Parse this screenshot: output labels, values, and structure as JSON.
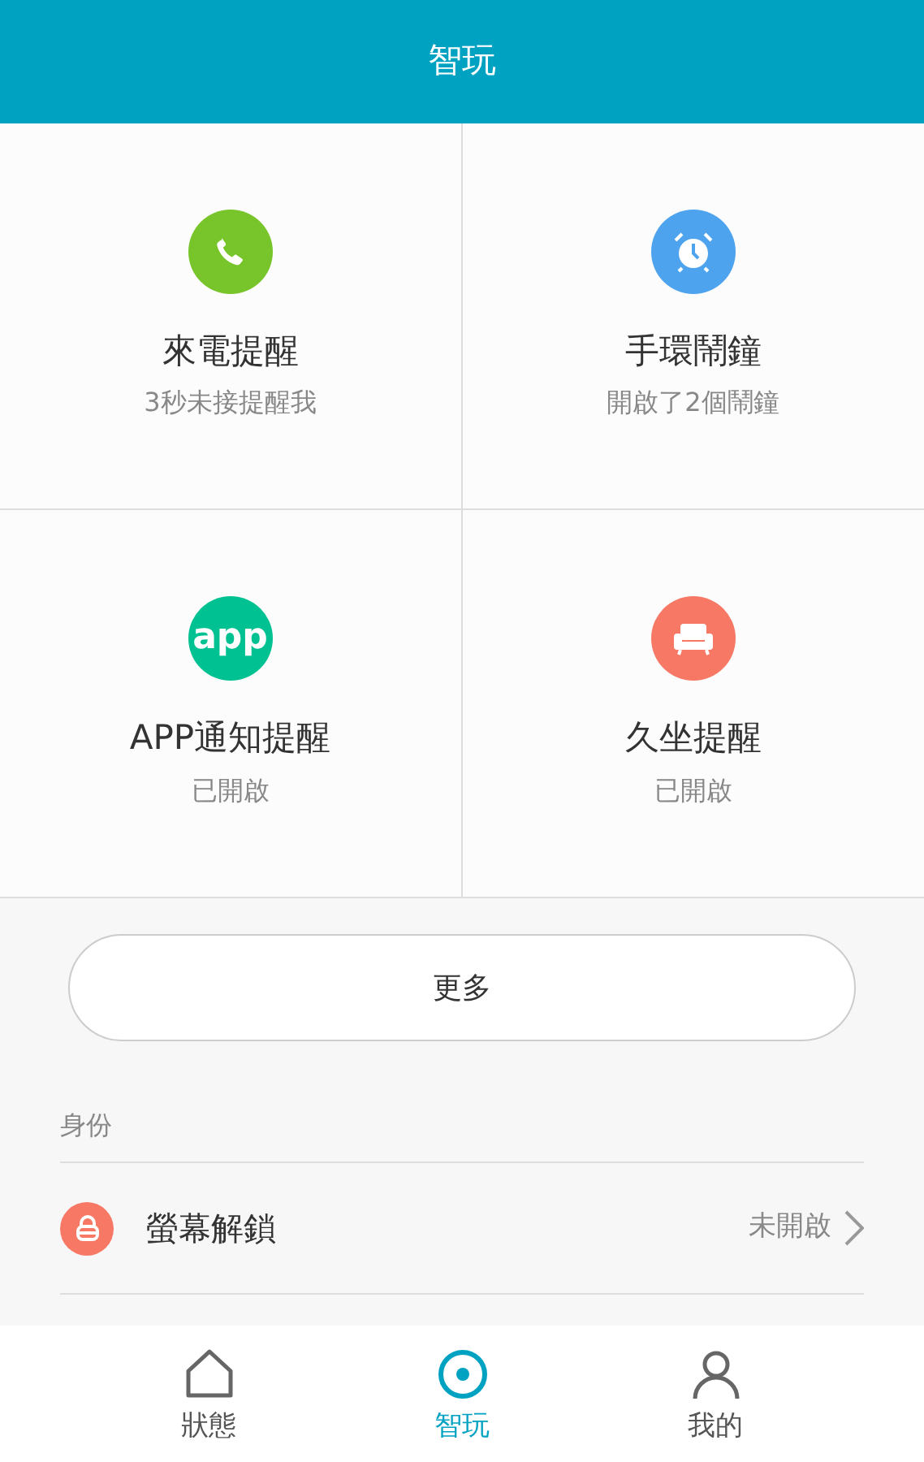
{
  "header": {
    "title": "智玩"
  },
  "tiles": [
    {
      "kind": "phone",
      "color": "#77c52b",
      "title": "來電提醒",
      "subtitle": "3秒未接提醒我"
    },
    {
      "kind": "alarm",
      "color": "#4ea3ef",
      "title": "手環鬧鐘",
      "subtitle": "開啟了2個鬧鐘"
    },
    {
      "kind": "app",
      "color": "#00c191",
      "icon_text": "app",
      "title": "APP通知提醒",
      "subtitle": "已開啟"
    },
    {
      "kind": "sofa",
      "color": "#f77865",
      "title": "久坐提醒",
      "subtitle": "已開啟"
    }
  ],
  "more_button": "更多",
  "section": {
    "label": "身份",
    "rows": [
      {
        "title": "螢幕解鎖",
        "value": "未開啟"
      }
    ]
  },
  "tabs": [
    {
      "kind": "home",
      "label": "狀態",
      "selected": false
    },
    {
      "kind": "target",
      "label": "智玩",
      "selected": true
    },
    {
      "kind": "person",
      "label": "我的",
      "selected": false
    }
  ]
}
